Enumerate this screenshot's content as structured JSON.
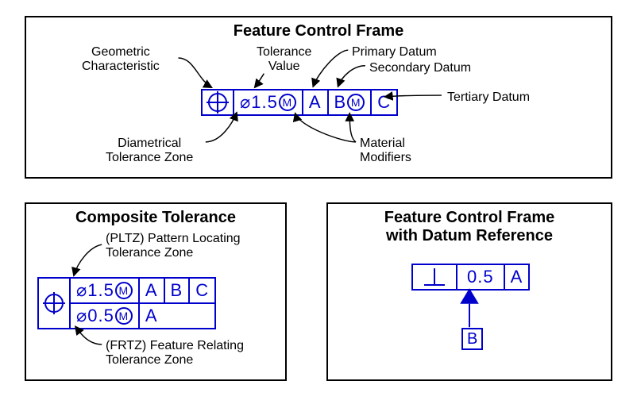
{
  "panel1": {
    "title": "Feature Control Frame",
    "labels": {
      "geometric_characteristic": "Geometric\nCharacteristic",
      "tolerance_value": "Tolerance\nValue",
      "primary_datum": "Primary Datum",
      "secondary_datum": "Secondary Datum",
      "tertiary_datum": "Tertiary Datum",
      "diametrical_zone": "Diametrical\nTolerance Zone",
      "material_modifiers": "Material\nModifiers"
    },
    "fcf": {
      "symbol": "position",
      "tolerance": "⌀1.5",
      "tol_modifier": "M",
      "datums": [
        {
          "letter": "A",
          "modifier": null
        },
        {
          "letter": "B",
          "modifier": "M"
        },
        {
          "letter": "C",
          "modifier": null
        }
      ]
    }
  },
  "panel2": {
    "title": "Composite Tolerance",
    "labels": {
      "pltz": "(PLTZ) Pattern Locating\nTolerance Zone",
      "frtz": "(FRTZ) Feature Relating\nTolerance Zone"
    },
    "fcf": {
      "symbol": "position",
      "rows": [
        {
          "tolerance": "⌀1.5",
          "tol_modifier": "M",
          "datums": [
            "A",
            "B",
            "C"
          ]
        },
        {
          "tolerance": "⌀0.5",
          "tol_modifier": "M",
          "datums": [
            "A"
          ]
        }
      ]
    }
  },
  "panel3": {
    "title_line1": "Feature Control Frame",
    "title_line2": "with Datum Reference",
    "fcf": {
      "symbol": "perpendicularity",
      "tolerance": "0.5",
      "datums": [
        "A"
      ]
    },
    "datum_ref": "B"
  }
}
